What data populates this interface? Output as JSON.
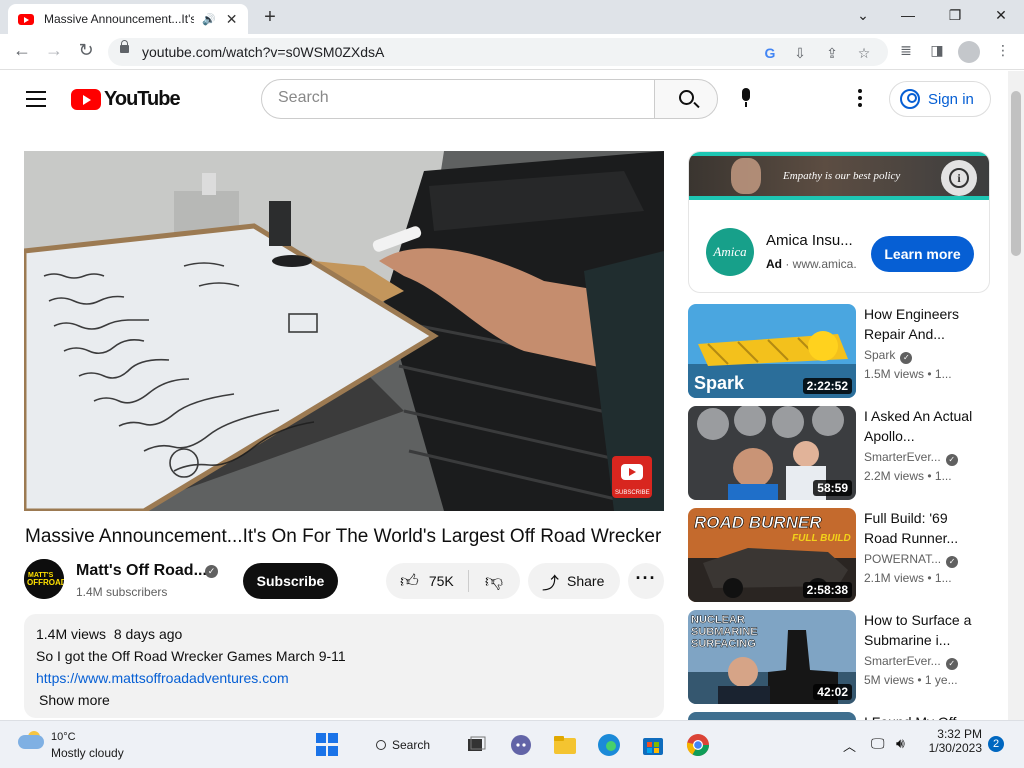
{
  "browser": {
    "tab_title": "Massive Announcement...It's",
    "url": "youtube.com/watch?v=s0WSM0ZXdsA"
  },
  "youtube": {
    "logo_text": "YouTube",
    "search_placeholder": "Search",
    "signin_label": "Sign in"
  },
  "video": {
    "title": "Massive Announcement...It's On For The World's Largest Off Road Wrecker",
    "channel": "Matt's Off Road...",
    "subscribers": "1.4M subscribers",
    "subscribe_label": "Subscribe",
    "likes": "75K",
    "share_label": "Share",
    "views": "1.4M views",
    "age": "8 days ago",
    "desc_line": "So I got the Off Road Wrecker Games March 9-11",
    "desc_link": "https://www.mattsoffroadadventures.com",
    "show_more": "Show more",
    "watermark": "SUBSCRIBE"
  },
  "ad": {
    "banner_text": "Empathy is our best policy",
    "logo_text": "Amica",
    "name": "Amica Insu...",
    "ad_label": "Ad",
    "domain": "www.amica.",
    "cta": "Learn more"
  },
  "related": [
    {
      "title": "How Engineers Repair And...",
      "channel": "Spark",
      "views": "1.5M views",
      "age": "1...",
      "duration": "2:22:52",
      "thumb_text": "Spark"
    },
    {
      "title": "I Asked An Actual Apollo...",
      "channel": "SmarterEver...",
      "views": "2.2M views",
      "age": "1...",
      "duration": "58:59",
      "thumb_text": ""
    },
    {
      "title": "Full Build: '69 Road Runner...",
      "channel": "POWERNAT...",
      "views": "2.1M views",
      "age": "1...",
      "duration": "2:58:38",
      "thumb_text": "ROAD BURNER",
      "thumb_sub": "FULL BUILD"
    },
    {
      "title": "How to Surface a Submarine i...",
      "channel": "SmarterEver...",
      "views": "5M views",
      "age": "1 ye...",
      "duration": "42:02",
      "thumb_text": "NUCLEAR SUBMARINE SURFACING"
    },
    {
      "title": "I Found My Off...",
      "channel": "",
      "views": "",
      "age": "",
      "duration": "",
      "thumb_text": ""
    }
  ],
  "taskbar": {
    "temp": "10°C",
    "weather": "Mostly cloudy",
    "search_label": "Search",
    "time": "3:32 PM",
    "date": "1/30/2023",
    "notifications": "2"
  }
}
